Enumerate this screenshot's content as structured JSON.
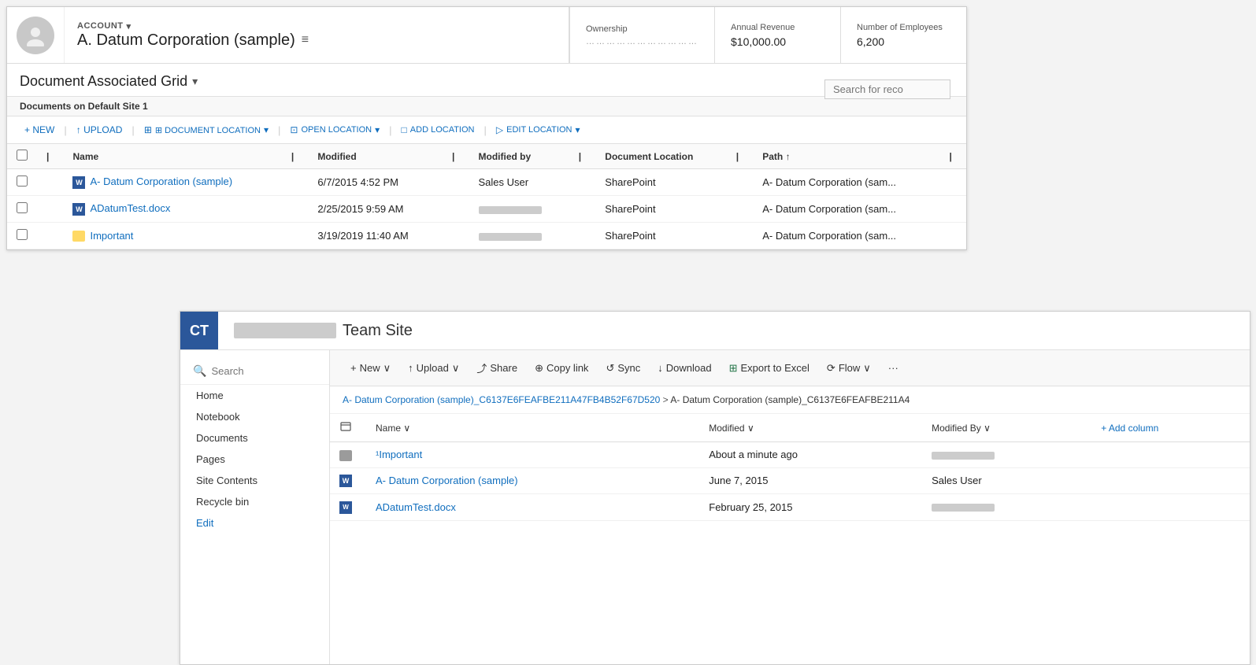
{
  "crm": {
    "account": {
      "label": "ACCOUNT",
      "name": "A. Datum Corporation (sample)",
      "ownership_label": "Ownership",
      "ownership_value": "……………………………",
      "annual_revenue_label": "Annual Revenue",
      "annual_revenue_value": "$10,000.00",
      "employees_label": "Number of Employees",
      "employees_value": "6,200"
    },
    "dag": {
      "title": "Document Associated Grid",
      "search_placeholder": "Search for reco",
      "site_bar": "Documents on Default Site 1",
      "toolbar": {
        "new": "+ NEW",
        "upload": "↑ UPLOAD",
        "document_location": "⊞ DOCUMENT LOCATION",
        "open_location": "⊡ OPEN LOCATION",
        "add_location": "□ ADD LOCATION",
        "edit_location": "▷ EDIT LOCATION"
      },
      "columns": [
        "Name",
        "Modified",
        "Modified by",
        "Document Location",
        "Path ↑"
      ],
      "rows": [
        {
          "icon": "word",
          "name": "A- Datum Corporation (sample)",
          "modified": "6/7/2015 4:52 PM",
          "modified_by": "Sales User",
          "doc_location": "SharePoint",
          "path": "A- Datum Corporation (sam..."
        },
        {
          "icon": "word",
          "name": "ADatumTest.docx",
          "modified": "2/25/2015 9:59 AM",
          "modified_by": "████████████",
          "doc_location": "SharePoint",
          "path": "A- Datum Corporation (sam..."
        },
        {
          "icon": "folder",
          "name": "Important",
          "modified": "3/19/2019 11:40 AM",
          "modified_by": "████ ████",
          "doc_location": "SharePoint",
          "path": "A- Datum Corporation (sam..."
        }
      ]
    }
  },
  "sharepoint": {
    "logo_text": "CT",
    "site_name": "Team Site",
    "site_name_blurred": true,
    "search_placeholder": "Search",
    "nav_items": [
      "Home",
      "Notebook",
      "Documents",
      "Pages",
      "Site Contents",
      "Recycle bin",
      "Edit"
    ],
    "toolbar": {
      "new": "+ New",
      "upload": "↑ Upload",
      "share": "⤴ Share",
      "copy_link": "⊕ Copy link",
      "sync": "↺ Sync",
      "download": "↓ Download",
      "export": "⊞ Export to Excel",
      "flow": "⟳ Flow",
      "more": "···"
    },
    "breadcrumb": {
      "part1": "A- Datum Corporation (sample)_C6137E6FEAFBE211A47FB4B52F67D520",
      "separator": " > ",
      "part2": "A- Datum Corporation (sample)_C6137E6FEAFBE211A4"
    },
    "table": {
      "columns": [
        "Name",
        "Modified",
        "Modified By",
        "+ Add column"
      ],
      "rows": [
        {
          "icon": "folder",
          "name": "¹Important",
          "modified": "About a minute ago",
          "modified_by_blurred": true,
          "modified_by": "████ ████"
        },
        {
          "icon": "word",
          "name": "A- Datum Corporation (sample)",
          "modified": "June 7, 2015",
          "modified_by": "Sales User",
          "modified_by_blurred": false
        },
        {
          "icon": "word-small",
          "name": "ADatumTest.docx",
          "modified": "February 25, 2015",
          "modified_by_blurred": true,
          "modified_by": "████████████"
        }
      ]
    }
  }
}
